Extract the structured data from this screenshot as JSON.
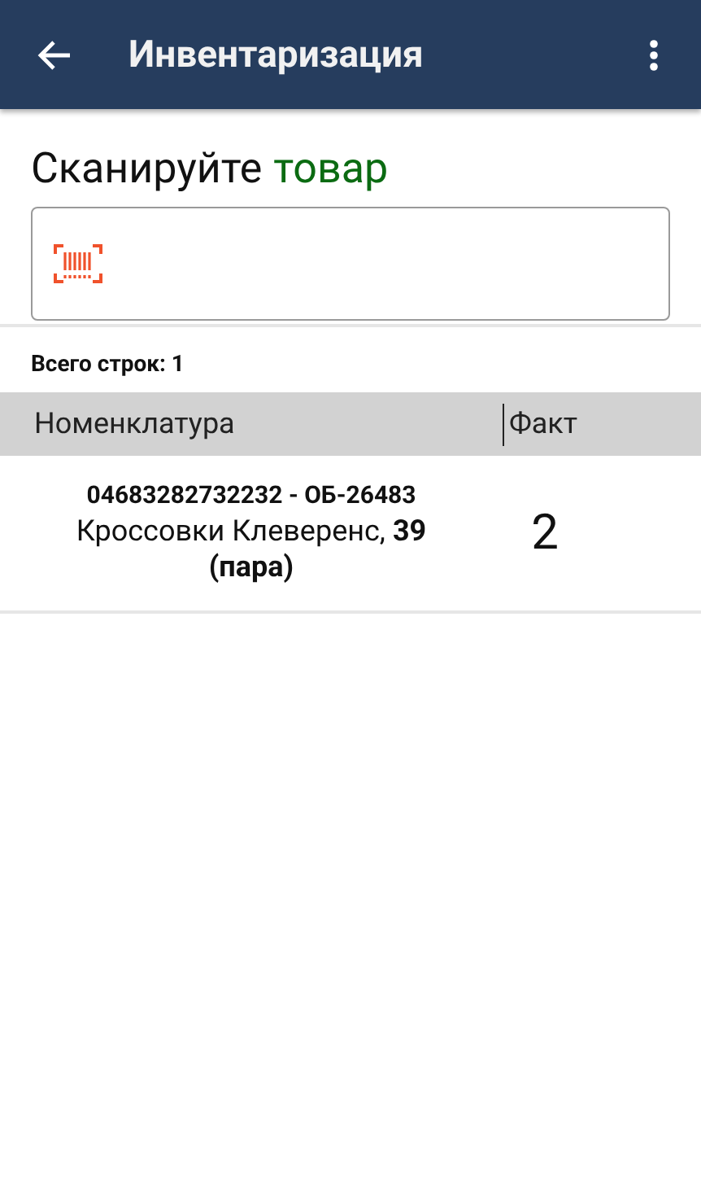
{
  "app_bar": {
    "title": "Инвентаризация"
  },
  "prompt": {
    "text": "Сканируйте",
    "highlight": "товар"
  },
  "total": "Всего строк: 1",
  "table": {
    "columns": [
      "Номенклатура",
      "Факт"
    ],
    "rows": [
      {
        "code": "04683282732232 - ОБ-26483",
        "name": "Кроссовки Клеверенс, **39 (пара)**",
        "qty": "2"
      }
    ]
  }
}
